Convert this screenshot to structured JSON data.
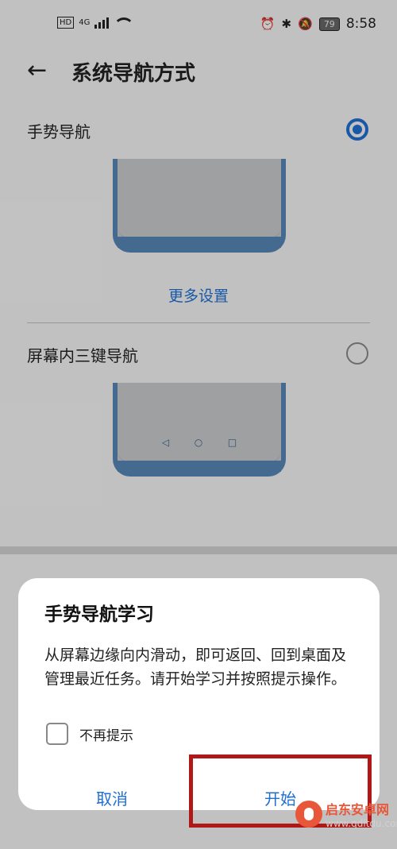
{
  "status_bar": {
    "network_badge": "HD",
    "signal_tag": "4G",
    "battery": "79",
    "time": "8:58",
    "icons": [
      "alarm-icon",
      "bluetooth-icon",
      "mute-icon"
    ]
  },
  "header": {
    "back_icon": "arrow-left-icon",
    "title": "系统导航方式"
  },
  "options": [
    {
      "label": "手势导航",
      "selected": true
    },
    {
      "label": "屏幕内三键导航",
      "selected": false
    }
  ],
  "more_settings": "更多设置",
  "nav_keys": [
    "◁",
    "○",
    "□"
  ],
  "dialog": {
    "title": "手势导航学习",
    "body": "从屏幕边缘向内滑动，即可返回、回到桌面及管理最近任务。请开始学习并按照提示操作。",
    "checkbox_label": "不再提示",
    "checkbox_checked": false,
    "cancel_label": "取消",
    "start_label": "开始"
  },
  "watermark": {
    "name": "启东安卓网",
    "url": "www.qdltdu.com"
  },
  "colors": {
    "accent": "#1f6fd1",
    "phone_frame": "#5585b5",
    "highlight": "#b01818"
  }
}
